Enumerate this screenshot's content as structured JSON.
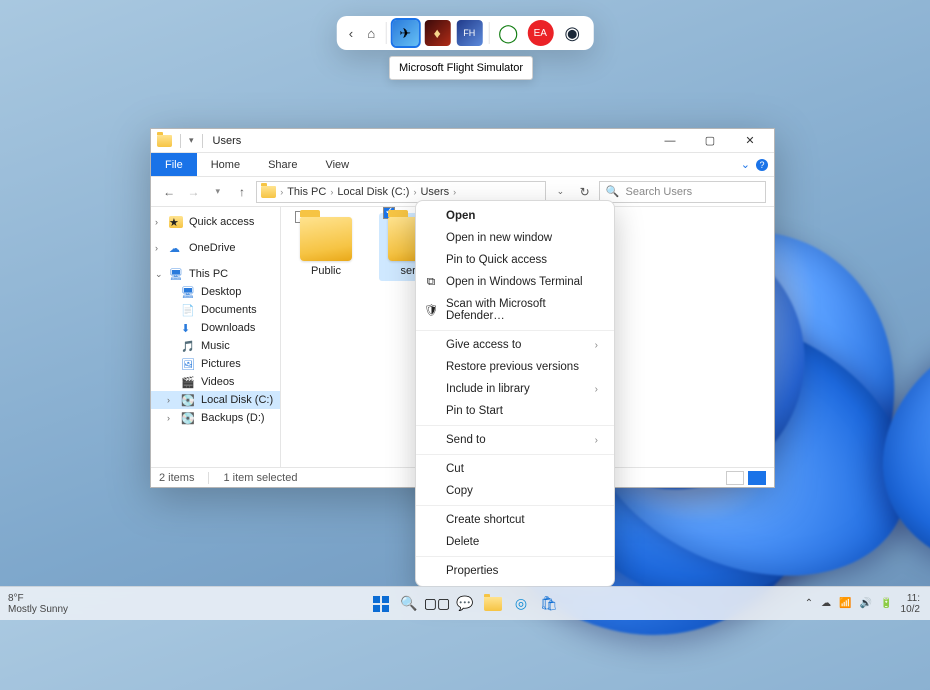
{
  "dock": {
    "tooltip": "Microsoft Flight Simulator",
    "tiles": [
      "flight-sim",
      "diablo",
      "forza",
      "xbox",
      "ea",
      "steam"
    ]
  },
  "window": {
    "title": "Users",
    "ribbon": {
      "file": "File",
      "tabs": [
        "Home",
        "Share",
        "View"
      ]
    },
    "nav": {
      "crumbs": [
        "This PC",
        "Local Disk (C:)",
        "Users"
      ],
      "search_placeholder": "Search Users"
    },
    "sidebar": {
      "quick_access": "Quick access",
      "onedrive": "OneDrive",
      "this_pc": "This PC",
      "children": [
        "Desktop",
        "Documents",
        "Downloads",
        "Music",
        "Pictures",
        "Videos",
        "Local Disk (C:)",
        "Backups (D:)"
      ]
    },
    "folders": [
      {
        "name": "Public",
        "selected": false
      },
      {
        "name": "serdy",
        "selected": true
      }
    ],
    "status": {
      "count": "2 items",
      "sel": "1 item selected"
    }
  },
  "context_menu": {
    "groups": [
      [
        {
          "label": "Open",
          "bold": true
        },
        {
          "label": "Open in new window"
        },
        {
          "label": "Pin to Quick access"
        },
        {
          "label": "Open in Windows Terminal",
          "icon": "terminal"
        },
        {
          "label": "Scan with Microsoft Defender…",
          "icon": "shield"
        }
      ],
      [
        {
          "label": "Give access to",
          "sub": true
        },
        {
          "label": "Restore previous versions"
        },
        {
          "label": "Include in library",
          "sub": true
        },
        {
          "label": "Pin to Start"
        }
      ],
      [
        {
          "label": "Send to",
          "sub": true
        }
      ],
      [
        {
          "label": "Cut"
        },
        {
          "label": "Copy"
        }
      ],
      [
        {
          "label": "Create shortcut"
        },
        {
          "label": "Delete"
        }
      ],
      [
        {
          "label": "Properties"
        }
      ]
    ]
  },
  "taskbar": {
    "weather_temp": "8°F",
    "weather_desc": "Mostly Sunny",
    "time": "11:",
    "date": "10/2"
  }
}
